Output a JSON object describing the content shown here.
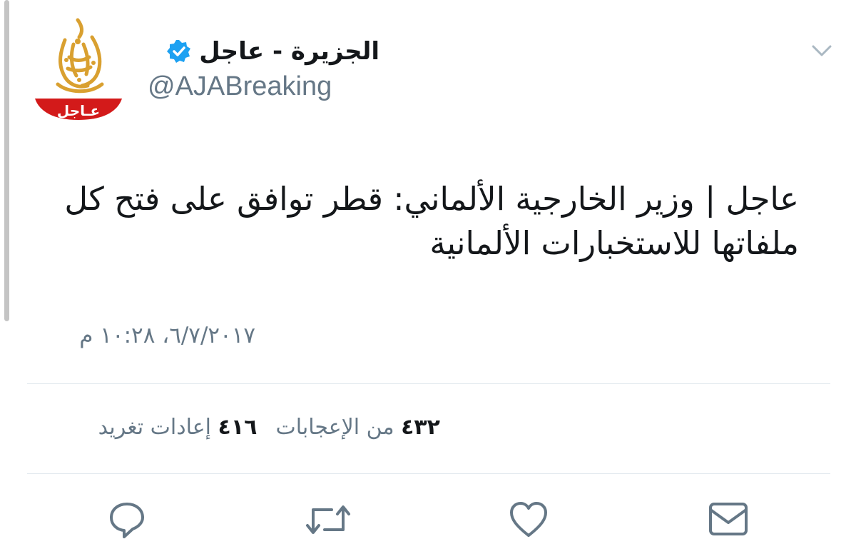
{
  "user": {
    "display_name": "الجزيرة - عاجل",
    "handle": "@AJABreaking",
    "verified": true,
    "avatar_label": "عـاجل"
  },
  "tweet": {
    "text": "عاجل | وزير الخارجية الألماني: قطر توافق على فتح كل ملفاتها للاستخبارات الألمانية",
    "timestamp": "٦/٧/٢٠١٧، ١٠:٢٨ م"
  },
  "stats": {
    "retweets_count": "٤١٦",
    "retweets_label": "إعادات تغريد",
    "likes_count": "٤٣٢",
    "likes_label": "من الإعجابات"
  },
  "colors": {
    "text_primary": "#14171a",
    "text_secondary": "#657786",
    "verified_blue": "#1da1f2",
    "divider": "#e1e8ed",
    "icon": "#657786",
    "brand_gold": "#d9a030",
    "brand_red": "#d31a1a"
  },
  "icons": {
    "menu": "chevron-down-icon",
    "reply": "reply-icon",
    "retweet": "retweet-icon",
    "like": "heart-icon",
    "message": "envelope-icon"
  }
}
